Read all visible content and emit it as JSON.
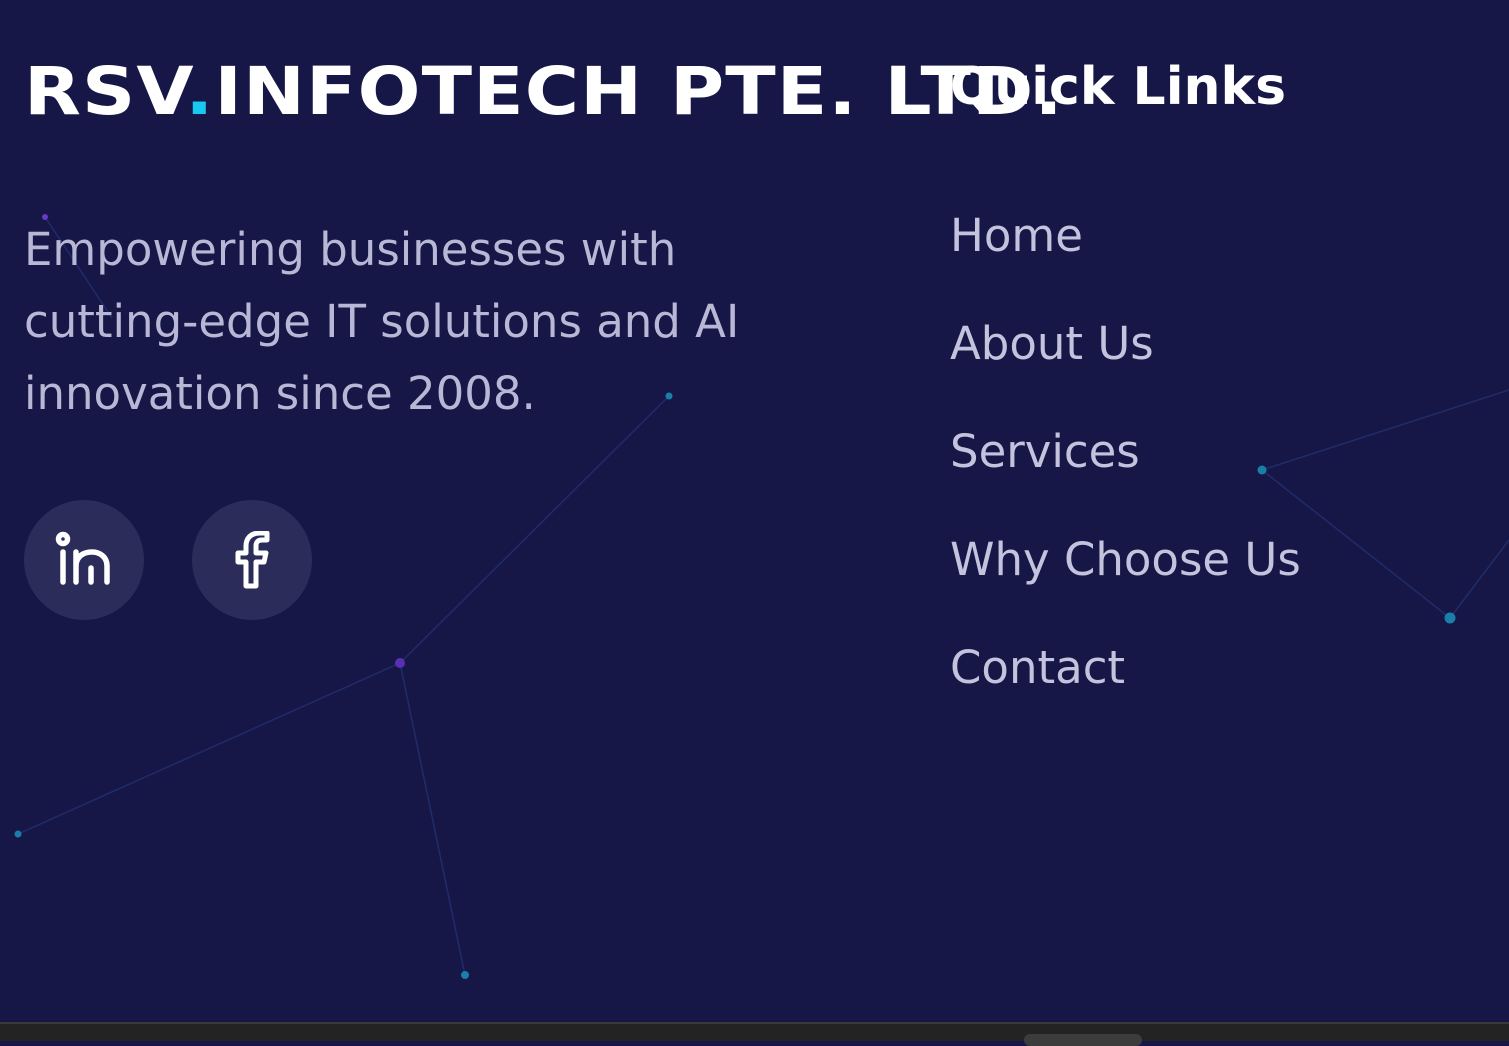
{
  "brand": {
    "name_part1": "RSV",
    "dot": ".",
    "name_part2": "INFOTECH PTE. LTD."
  },
  "tagline": "Empowering businesses with cutting-edge IT solutions and AI innovation since 2008.",
  "social": [
    {
      "icon": "linkedin-icon"
    },
    {
      "icon": "facebook-icon"
    }
  ],
  "quick_links": {
    "title": "Quick Links",
    "items": [
      "Home",
      "About Us",
      "Services",
      "Why Choose Us",
      "Contact"
    ]
  },
  "colors": {
    "background": "#161746",
    "accent": "#18c8f0",
    "text": "#b9b7d6",
    "heading": "#ffffff",
    "social_bg": "#2c2c5b"
  }
}
